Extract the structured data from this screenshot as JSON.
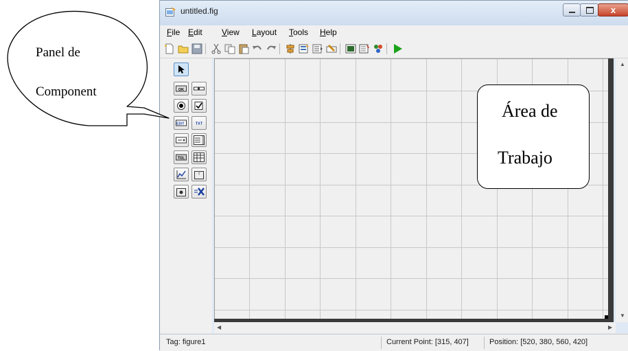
{
  "window": {
    "title": "untitled.fig",
    "close_glyph": "x"
  },
  "menu": {
    "items": [
      {
        "key": "F",
        "rest": "ile"
      },
      {
        "key": "E",
        "rest": "dit"
      },
      {
        "key": "V",
        "rest": "iew"
      },
      {
        "key": "L",
        "rest": "ayout"
      },
      {
        "key": "T",
        "rest": "ools"
      },
      {
        "key": "H",
        "rest": "elp"
      }
    ]
  },
  "toolbar": {
    "icons": [
      "new-file-icon",
      "open-folder-icon",
      "save-icon",
      "cut-icon",
      "copy-icon",
      "paste-icon",
      "undo-icon",
      "redo-icon",
      "align-objects-icon",
      "menu-editor-icon",
      "tab-order-icon",
      "toolbar-editor-icon",
      "editor-icon",
      "property-inspector-icon",
      "object-browser-icon",
      "run-figure-icon"
    ]
  },
  "palette": {
    "labels": {
      "push": "OK",
      "edit": "EDIT",
      "text": "TXT",
      "toggle": "TGL"
    }
  },
  "status": {
    "tag": "Tag: figure1",
    "current_point": "Current Point:  [315, 407]",
    "position": "Position: [520, 380, 560, 420]"
  },
  "callouts": {
    "panel": {
      "line1": "Panel de",
      "line2": "Component"
    },
    "area": {
      "line1": "Área de",
      "line2": "Trabajo"
    }
  },
  "colors": {
    "run_green": "#1aa31a",
    "select_blue": "#cfe4f7"
  }
}
